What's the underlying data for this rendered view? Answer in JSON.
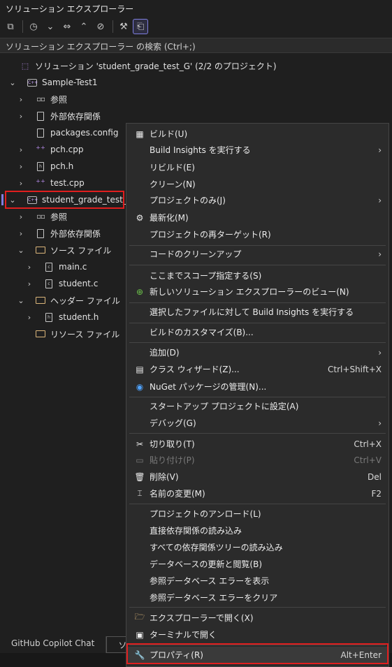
{
  "title": "ソリューション エクスプローラー",
  "toolbar": {
    "buttons": [
      {
        "name": "switch-views-icon",
        "glyph": "⧉"
      },
      {
        "name": "history-icon",
        "glyph": "◷"
      },
      {
        "name": "chevron-down-icon",
        "glyph": "⌄"
      },
      {
        "name": "sync-icon",
        "glyph": "⇔"
      },
      {
        "name": "collapse-all-icon",
        "glyph": "⌃"
      },
      {
        "name": "show-all-files-icon",
        "glyph": "⊘"
      },
      {
        "name": "properties-wrench-icon",
        "glyph": "🔧"
      },
      {
        "name": "preview-icon",
        "glyph": "⎗"
      }
    ]
  },
  "search": {
    "placeholder": "ソリューション エクスプローラー の検索 (Ctrl+;)"
  },
  "tree": {
    "solution": "ソリューション 'student_grade_test_G' (2/2 のプロジェクト)",
    "project1": "Sample-Test1",
    "p1_refs": "参照",
    "p1_external": "外部依存関係",
    "p1_packages": "packages.config",
    "p1_pchcpp": "pch.cpp",
    "p1_pchh": "pch.h",
    "p1_testcpp": "test.cpp",
    "project2": "student_grade_test_G",
    "p2_refs": "参照",
    "p2_external": "外部依存関係",
    "p2_source": "ソース ファイル",
    "p2_mainc": "main.c",
    "p2_studentc": "student.c",
    "p2_header": "ヘッダー ファイル",
    "p2_studenth": "student.h",
    "p2_resource": "リソース ファイル"
  },
  "tabs": {
    "copilot": "GitHub Copilot Chat",
    "solution": "ソリュー"
  },
  "menu": {
    "build": "ビルド(U)",
    "build_insights": "Build Insights を実行する",
    "rebuild": "リビルド(E)",
    "clean": "クリーン(N)",
    "project_only": "プロジェクトのみ(J)",
    "refresh": "最新化(M)",
    "retarget": "プロジェクトの再ターゲット(R)",
    "code_cleanup": "コードのクリーンアップ",
    "scope": "ここまでスコープ指定する(S)",
    "new_view": "新しいソリューション エクスプローラーのビュー(N)",
    "build_insights_selected": "選択したファイルに対して Build Insights を実行する",
    "build_customize": "ビルドのカスタマイズ(B)...",
    "add": "追加(D)",
    "class_wizard": "クラス ウィザード(Z)...",
    "class_wizard_shortcut": "Ctrl+Shift+X",
    "nuget": "NuGet パッケージの管理(N)...",
    "startup": "スタートアップ プロジェクトに設定(A)",
    "debug": "デバッグ(G)",
    "cut": "切り取り(T)",
    "cut_shortcut": "Ctrl+X",
    "paste": "貼り付け(P)",
    "paste_shortcut": "Ctrl+V",
    "delete": "削除(V)",
    "delete_shortcut": "Del",
    "rename": "名前の変更(M)",
    "rename_shortcut": "F2",
    "unload": "プロジェクトのアンロード(L)",
    "load_direct": "直接依存関係の読み込み",
    "load_all": "すべての依存関係ツリーの読み込み",
    "db_update": "データベースの更新と閲覧(B)",
    "db_show_errors": "参照データベース エラーを表示",
    "db_clear_errors": "参照データベース エラーをクリア",
    "open_explorer": "エクスプローラーで開く(X)",
    "open_terminal": "ターミナルで開く",
    "properties": "プロパティ(R)",
    "properties_shortcut": "Alt+Enter"
  },
  "colors": {
    "highlight": "#e01e1e",
    "accent": "#7f7fe0",
    "menu_bg": "#2b2b2b",
    "bg": "#1f1f1f"
  }
}
